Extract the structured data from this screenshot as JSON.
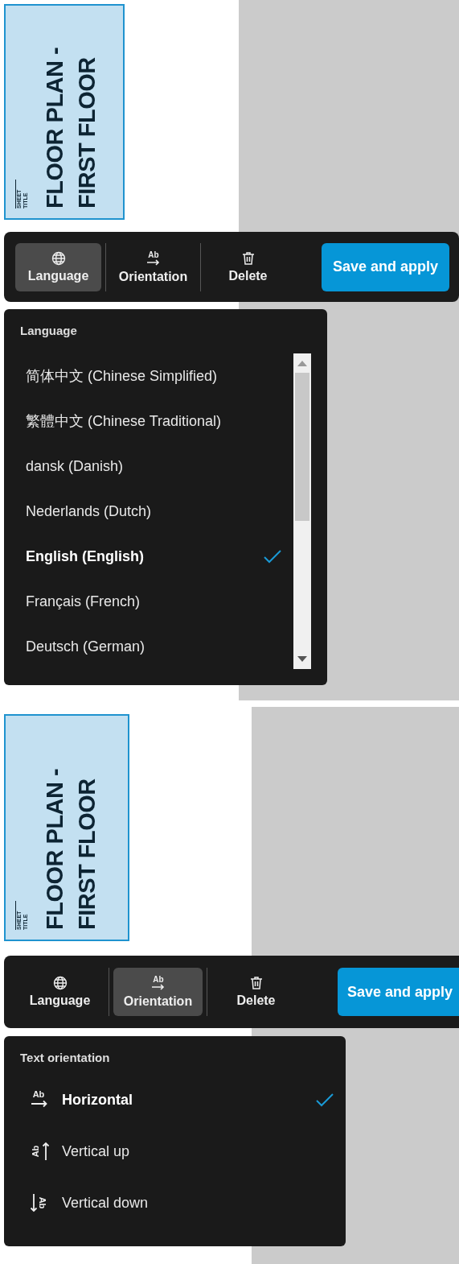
{
  "panels": [
    {
      "sheet": {
        "label": "SHEET TITLE",
        "title": "FLOOR PLAN - FIRST FLOOR"
      },
      "toolbar": {
        "tools": [
          {
            "kind": "language",
            "label": "Language",
            "selected": true
          },
          {
            "kind": "orientation",
            "label": "Orientation",
            "icon_text": "Ab",
            "selected": false
          },
          {
            "kind": "delete",
            "label": "Delete",
            "selected": false
          }
        ],
        "save_button": "Save and apply"
      },
      "menu": {
        "kind": "language",
        "title": "Language",
        "items": [
          {
            "label": "简体中文 (Chinese Simplified)",
            "selected": false
          },
          {
            "label": "繁體中文 (Chinese Traditional)",
            "selected": false
          },
          {
            "label": "dansk (Danish)",
            "selected": false
          },
          {
            "label": "Nederlands (Dutch)",
            "selected": false
          },
          {
            "label": "English (English)",
            "selected": true
          },
          {
            "label": "Français (French)",
            "selected": false
          },
          {
            "label": "Deutsch (German)",
            "selected": false
          }
        ]
      }
    },
    {
      "sheet": {
        "label": "SHEET TITLE",
        "title": "FLOOR PLAN - FIRST FLOOR"
      },
      "toolbar": {
        "tools": [
          {
            "kind": "language",
            "label": "Language",
            "selected": false
          },
          {
            "kind": "orientation",
            "label": "Orientation",
            "icon_text": "Ab",
            "selected": true
          },
          {
            "kind": "delete",
            "label": "Delete",
            "selected": false
          }
        ],
        "save_button": "Save and apply"
      },
      "menu": {
        "kind": "orientation",
        "title": "Text orientation",
        "items": [
          {
            "kind": "horizontal",
            "icon_text": "Ab",
            "label": "Horizontal",
            "selected": true
          },
          {
            "kind": "vertical-up",
            "icon_text": "Ab",
            "label": "Vertical up",
            "selected": false
          },
          {
            "kind": "vertical-down",
            "icon_text": "Ab",
            "label": "Vertical down",
            "selected": false
          }
        ]
      }
    }
  ]
}
